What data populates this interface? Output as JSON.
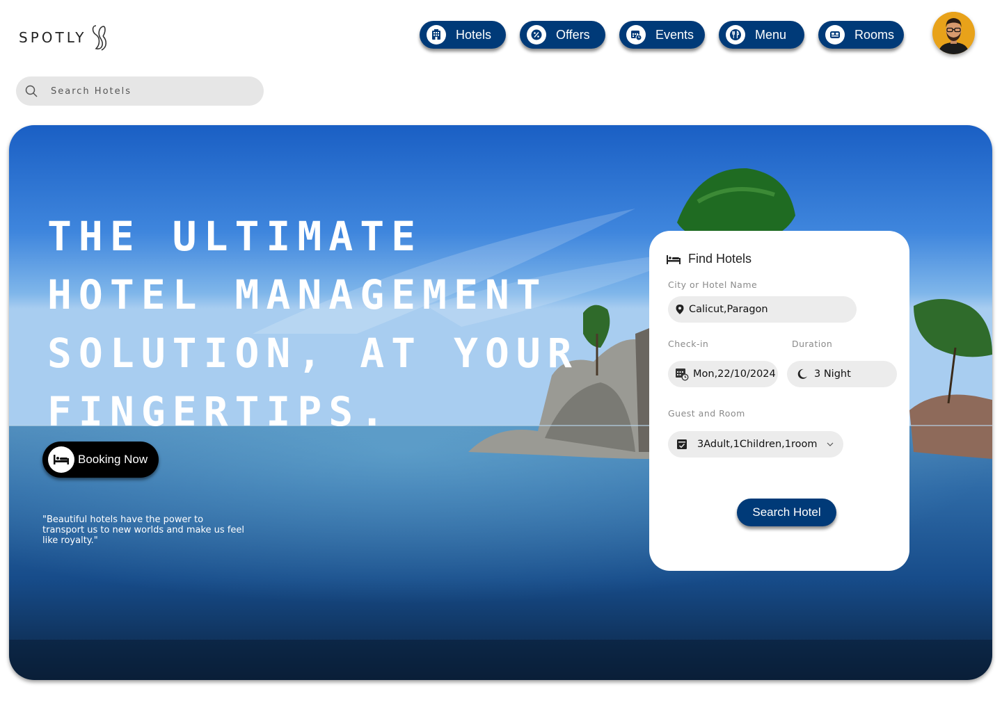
{
  "brand": {
    "name": "SPOTLY"
  },
  "nav": {
    "items": [
      {
        "label": "Hotels",
        "icon": "hotel-building-icon"
      },
      {
        "label": "Offers",
        "icon": "percent-badge-icon"
      },
      {
        "label": "Events",
        "icon": "calendar-clock-icon"
      },
      {
        "label": "Menu",
        "icon": "fork-knife-icon"
      },
      {
        "label": "Rooms",
        "icon": "bed-icon"
      }
    ],
    "color": "#003a78"
  },
  "search": {
    "placeholder": "Search Hotels"
  },
  "hero": {
    "headline": "THE ULTIMATE HOTEL MANAGEMENT SOLUTION, AT YOUR FINGERTIPS.",
    "cta_label": "Booking Now",
    "quote": "\"Beautiful hotels have the power to transport us to new worlds and make us feel like royalty.\""
  },
  "finder": {
    "title": "Find Hotels",
    "city_label": "City or Hotel Name",
    "city_value": "Calicut,Paragon",
    "checkin_label": "Check-in",
    "checkin_value": "Mon,22/10/2024",
    "duration_label": "Duration",
    "duration_value": "3 Night",
    "guests_label": "Guest and Room",
    "guests_value": "3Adult,1Children,1room",
    "submit_label": "Search Hotel"
  }
}
